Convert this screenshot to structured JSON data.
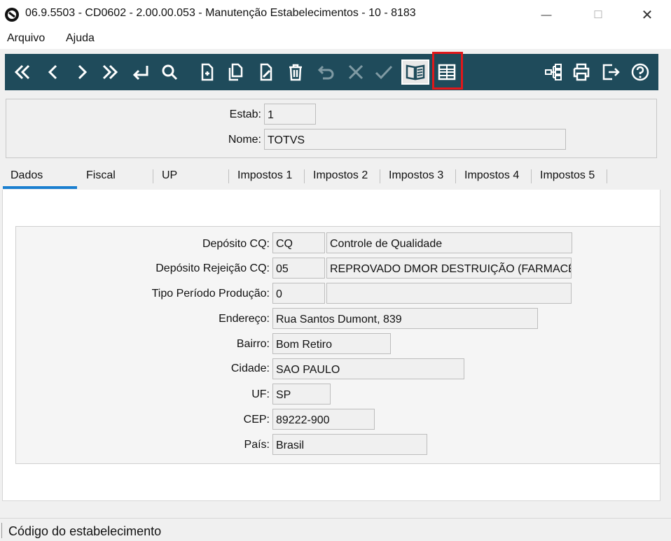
{
  "window": {
    "title": "06.9.5503 - CD0602 - 2.00.00.053 - Manutenção Estabelecimentos - 10 - 8183",
    "minimize_glyph": "—",
    "maximize_glyph": "☐",
    "close_glyph": "✕"
  },
  "menu": {
    "file": "Arquivo",
    "help": "Ajuda"
  },
  "toolbar": {
    "background": "#1f4b5b",
    "highlight_color": "#e0181b",
    "icons": [
      "first-record-icon",
      "previous-record-icon",
      "next-record-icon",
      "last-record-icon",
      "goto-record-icon",
      "search-icon",
      "new-record-icon",
      "copy-record-icon",
      "edit-record-icon",
      "delete-record-icon",
      "undo-icon",
      "cancel-icon",
      "confirm-icon",
      "open-book-icon",
      "list-view-icon",
      "tree-structure-icon",
      "print-icon",
      "exit-icon",
      "help-icon"
    ]
  },
  "header": {
    "estab_label": "Estab:",
    "estab_value": "1",
    "nome_label": "Nome:",
    "nome_value": "TOTVS"
  },
  "tabs": [
    "Dados",
    "Fiscal",
    "UP",
    "Impostos 1",
    "Impostos 2",
    "Impostos 3",
    "Impostos 4",
    "Impostos 5"
  ],
  "form": {
    "deposito_cq_label": "Depósito CQ:",
    "deposito_cq_code": "CQ",
    "deposito_cq_desc": "Controle de Qualidade",
    "deposito_rej_label": "Depósito Rejeição CQ:",
    "deposito_rej_code": "05",
    "deposito_rej_desc": "REPROVADO DMOR DESTRUIÇÃO (FARMACÊUT",
    "tipo_periodo_label": "Tipo Período Produção:",
    "tipo_periodo_code": "0",
    "tipo_periodo_desc": "",
    "endereco_label": "Endereço:",
    "endereco_value": "Rua Santos Dumont, 839",
    "bairro_label": "Bairro:",
    "bairro_value": "Bom Retiro",
    "cidade_label": "Cidade:",
    "cidade_value": "SAO PAULO",
    "uf_label": "UF:",
    "uf_value": "SP",
    "cep_label": "CEP:",
    "cep_value": "89222-900",
    "pais_label": "País:",
    "pais_value": "Brasil"
  },
  "status": {
    "text": "Código do estabelecimento"
  }
}
